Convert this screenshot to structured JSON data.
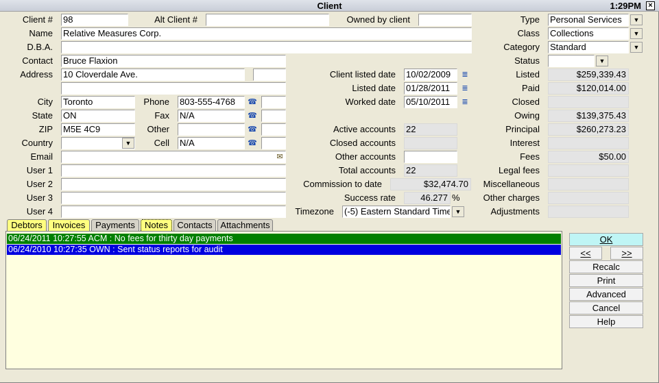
{
  "window": {
    "title": "Client",
    "clock": "1:29PM",
    "close_glyph": "×"
  },
  "left": {
    "client_no": {
      "label": "Client #",
      "value": "98"
    },
    "alt_client": {
      "label": "Alt Client #",
      "value": ""
    },
    "owned_by_client": {
      "label": "Owned by client",
      "value": ""
    },
    "name": {
      "label": "Name",
      "value": "Relative Measures Corp."
    },
    "dba": {
      "label": "D.B.A.",
      "value": ""
    },
    "contact": {
      "label": "Contact",
      "value": "Bruce Flaxion"
    },
    "address": {
      "label": "Address",
      "value": "10 Cloverdale Ave.",
      "value2": ""
    },
    "city": {
      "label": "City",
      "value": "Toronto"
    },
    "state": {
      "label": "State",
      "value": "ON"
    },
    "zip": {
      "label": "ZIP",
      "value": "M5E 4C9"
    },
    "country": {
      "label": "Country",
      "value": ""
    },
    "email": {
      "label": "Email",
      "value": ""
    },
    "user1": {
      "label": "User 1",
      "value": ""
    },
    "user2": {
      "label": "User 2",
      "value": ""
    },
    "user3": {
      "label": "User 3",
      "value": ""
    },
    "user4": {
      "label": "User 4",
      "value": ""
    },
    "phone": {
      "label": "Phone",
      "value": "803-555-4768"
    },
    "fax": {
      "label": "Fax",
      "value": "N/A"
    },
    "other": {
      "label": "Other",
      "value": ""
    },
    "cell": {
      "label": "Cell",
      "value": "N/A"
    }
  },
  "middle": {
    "client_listed_date": {
      "label": "Client listed date",
      "value": "10/02/2009"
    },
    "listed_date": {
      "label": "Listed date",
      "value": "01/28/2011"
    },
    "worked_date": {
      "label": "Worked date",
      "value": "05/10/2011"
    },
    "active_accounts": {
      "label": "Active accounts",
      "value": "22"
    },
    "closed_accounts": {
      "label": "Closed accounts",
      "value": ""
    },
    "other_accounts": {
      "label": "Other accounts",
      "value": ""
    },
    "total_accounts": {
      "label": "Total accounts",
      "value": "22"
    },
    "commission_to_date": {
      "label": "Commission to date",
      "value": "$32,474.70"
    },
    "success_rate": {
      "label": "Success rate",
      "value": "46.277",
      "unit": "%"
    },
    "timezone": {
      "label": "Timezone",
      "value": "(-5) Eastern Standard Time"
    }
  },
  "right": {
    "type": {
      "label": "Type",
      "value": "Personal Services"
    },
    "class": {
      "label": "Class",
      "value": "Collections"
    },
    "category": {
      "label": "Category",
      "value": "Standard"
    },
    "status": {
      "label": "Status",
      "value": ""
    },
    "listed": {
      "label": "Listed",
      "value": "$259,339.43"
    },
    "paid": {
      "label": "Paid",
      "value": "$120,014.00"
    },
    "closed": {
      "label": "Closed",
      "value": ""
    },
    "owing": {
      "label": "Owing",
      "value": "$139,375.43"
    },
    "principal": {
      "label": "Principal",
      "value": "$260,273.23"
    },
    "interest": {
      "label": "Interest",
      "value": ""
    },
    "fees": {
      "label": "Fees",
      "value": "$50.00"
    },
    "legal_fees": {
      "label": "Legal fees",
      "value": ""
    },
    "miscellaneous": {
      "label": "Miscellaneous",
      "value": ""
    },
    "other_charges": {
      "label": "Other charges",
      "value": ""
    },
    "adjustments": {
      "label": "Adjustments",
      "value": ""
    }
  },
  "tabs": [
    {
      "label": "Debtors",
      "color": "#ffff80"
    },
    {
      "label": "Invoices",
      "color": "#ffff80"
    },
    {
      "label": "Payments",
      "color": "#d6d3c8"
    },
    {
      "label": "Notes",
      "color": "#ffff80",
      "active": true
    },
    {
      "label": "Contacts",
      "color": "#d6d3c8"
    },
    {
      "label": "Attachments",
      "color": "#d6d3c8"
    }
  ],
  "notes": [
    {
      "text": "06/24/2011 10:27:55 ACM : No fees for thirty day payments",
      "bg": "#008000"
    },
    {
      "text": "06/24/2010 10:27:35 OWN : Sent status reports for audit",
      "bg": "#0000e0"
    }
  ],
  "buttons": {
    "ok": "OK",
    "prev": "<<",
    "next": ">>",
    "recalc": "Recalc",
    "print": "Print",
    "advanced": "Advanced",
    "cancel": "Cancel",
    "help": "Help"
  },
  "icons": {
    "phone": "phone-icon",
    "calendar": "calendar-icon",
    "dropdown": "chevron-down-icon",
    "email": "email-lookup-icon"
  },
  "colors": {
    "ok_bg": "#bff5f5",
    "tab_highlight": "#ffff80",
    "notes_bg": "#ffffe0"
  }
}
